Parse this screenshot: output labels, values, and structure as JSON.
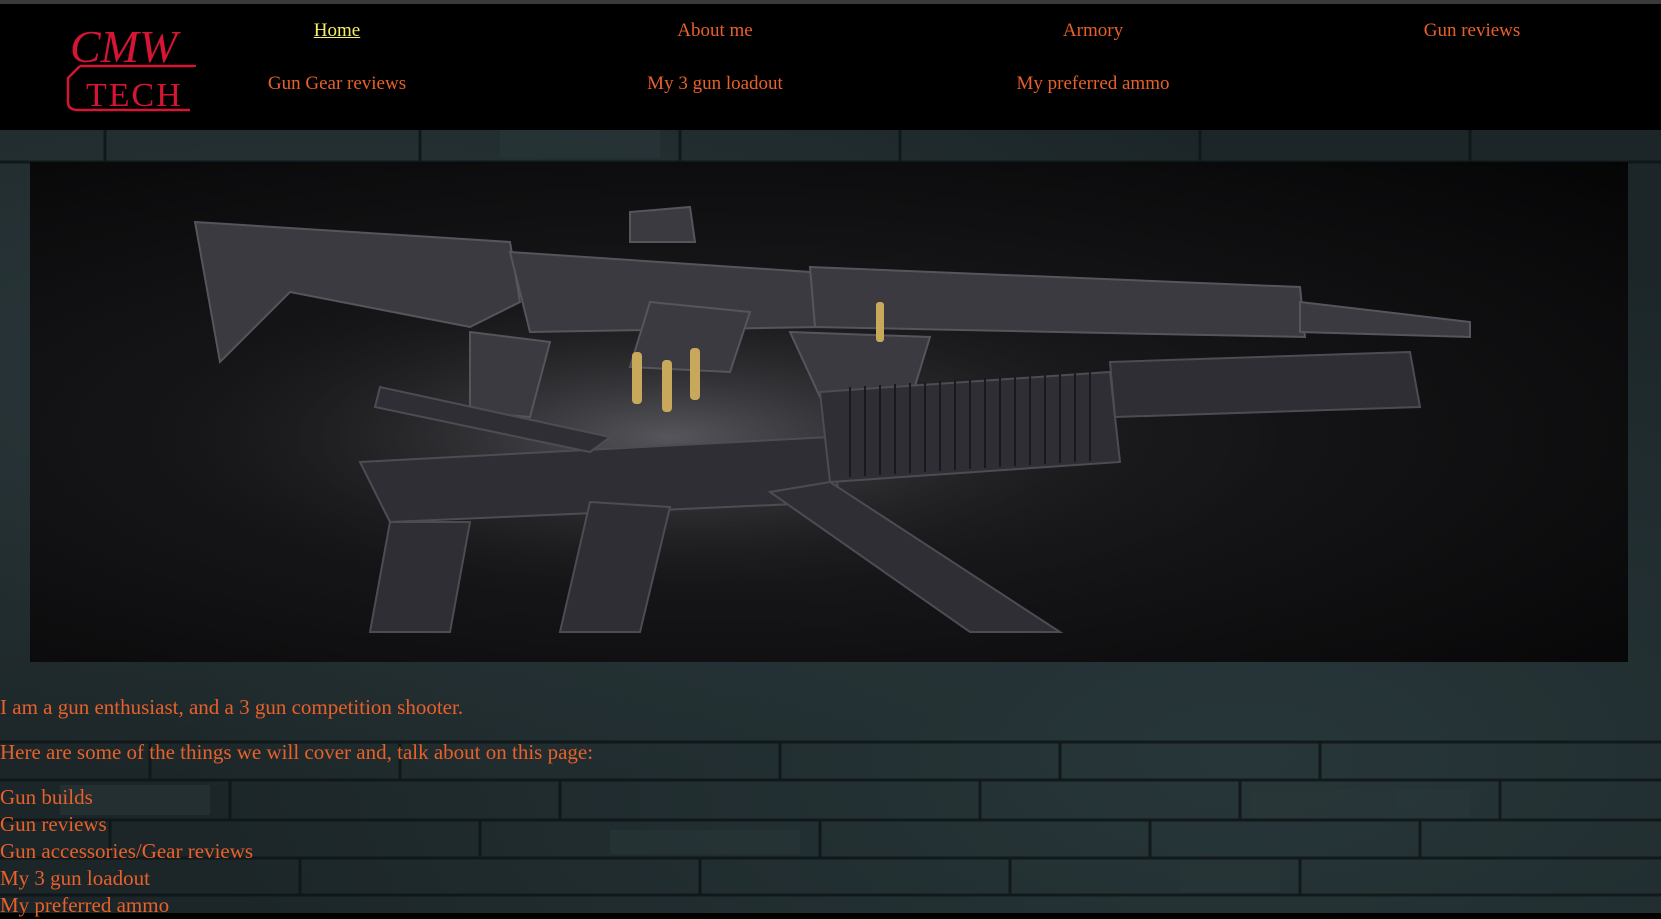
{
  "logo": {
    "line1": "CMW",
    "line2": "TECH",
    "color": "#d41534"
  },
  "nav": {
    "items": [
      {
        "label": "Home",
        "active": true
      },
      {
        "label": "About me"
      },
      {
        "label": "Armory"
      },
      {
        "label": "Gun reviews"
      },
      {
        "label": "Gun Gear reviews"
      },
      {
        "label": "My 3 gun loadout"
      },
      {
        "label": "My preferred ammo"
      }
    ]
  },
  "hero": {
    "icon": "rifles-and-submachine-gun-photo"
  },
  "content": {
    "intro": "I am a gun enthusiast, and a 3 gun competition shooter.",
    "lead": "Here are some of the things we will cover and, talk about on this page:",
    "topics": [
      "Gun builds",
      "Gun reviews",
      "Gun accessories/Gear reviews",
      "My 3 gun loadout",
      "My preferred ammo"
    ]
  },
  "colors": {
    "link": "#e8602a",
    "active_link": "#f4f06c",
    "background": "#000000"
  }
}
